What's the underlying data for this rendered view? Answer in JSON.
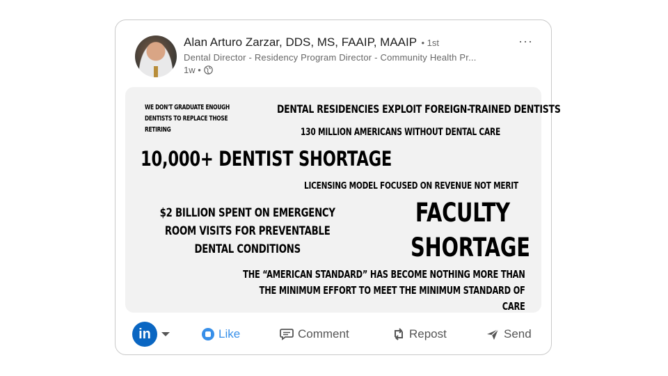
{
  "post": {
    "author_name": "Alan Arturo Zarzar, DDS, MS, FAAIP, MAAIP",
    "connection_degree": "• 1st",
    "headline": "Dental Director - Residency Program Director - Community Health Pr...",
    "time": "1w •",
    "more_label": "···"
  },
  "image_text": {
    "t1": "WE DON'T GRADUATE ENOUGH DENTISTS TO REPLACE THOSE RETIRING",
    "t2": "DENTAL RESIDENCIES EXPLOIT FOREIGN-TRAINED DENTISTS",
    "t3": "130 MILLION AMERICANS WITHOUT DENTAL CARE",
    "t4": "10,000+ DENTIST SHORTAGE",
    "t5": "LICENSING MODEL FOCUSED ON REVENUE NOT MERIT",
    "t6": "$2 BILLION SPENT ON EMERGENCY ROOM VISITS FOR PREVENTABLE DENTAL CONDITIONS",
    "t7": "FACULTY SHORTAGE",
    "t8": "THE “AMERICAN STANDARD” HAS BECOME NOTHING MORE THAN THE MINIMUM EFFORT TO MEET THE MINIMUM STANDARD OF CARE"
  },
  "actions": {
    "logo": "in",
    "like": "Like",
    "comment": "Comment",
    "repost": "Repost",
    "send": "Send"
  },
  "colors": {
    "brand": "#0a66c2",
    "like": "#378fe9"
  }
}
